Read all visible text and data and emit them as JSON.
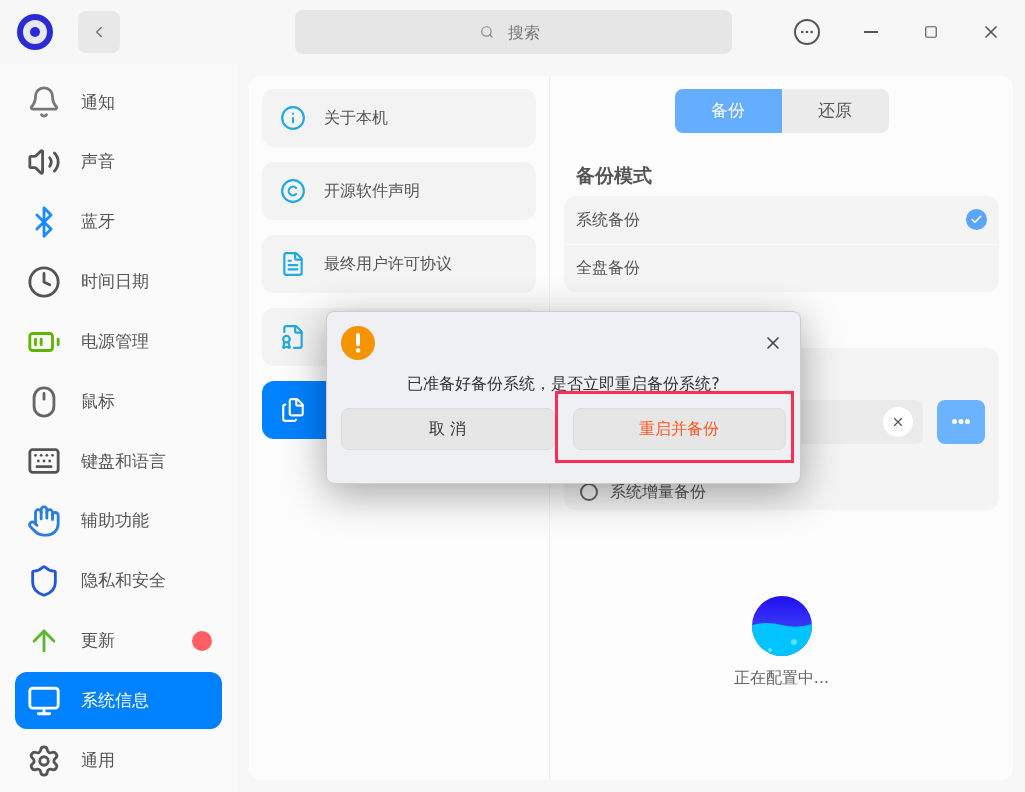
{
  "window": {
    "search": {
      "placeholder": "搜索"
    }
  },
  "sidebar": {
    "items": [
      {
        "label": "通知",
        "selected": false,
        "notification": false
      },
      {
        "label": "声音",
        "selected": false,
        "notification": false
      },
      {
        "label": "蓝牙",
        "selected": false,
        "notification": false
      },
      {
        "label": "时间日期",
        "selected": false,
        "notification": false
      },
      {
        "label": "电源管理",
        "selected": false,
        "notification": false
      },
      {
        "label": "鼠标",
        "selected": false,
        "notification": false
      },
      {
        "label": "键盘和语言",
        "selected": false,
        "notification": false
      },
      {
        "label": "辅助功能",
        "selected": false,
        "notification": false
      },
      {
        "label": "隐私和安全",
        "selected": false,
        "notification": false
      },
      {
        "label": "更新",
        "selected": false,
        "notification": true
      },
      {
        "label": "系统信息",
        "selected": true,
        "notification": false
      },
      {
        "label": "通用",
        "selected": false,
        "notification": false
      }
    ]
  },
  "info_menu": {
    "items": [
      {
        "label": "关于本机",
        "selected": false
      },
      {
        "label": "开源软件声明",
        "selected": false
      },
      {
        "label": "最终用户许可协议",
        "selected": false
      },
      {
        "selected": false
      },
      {
        "selected": true
      }
    ]
  },
  "backup": {
    "tabs": [
      {
        "label": "备份",
        "selected": true
      },
      {
        "label": "还原",
        "selected": false
      }
    ],
    "mode_title": "备份模式",
    "modes": [
      {
        "label": "系统备份",
        "checked": true
      },
      {
        "label": "全盘备份",
        "checked": false
      }
    ],
    "incremental_option": {
      "label": "系统增量备份",
      "selected": false
    },
    "status": "正在配置中..."
  },
  "dialog": {
    "message": "已准备好备份系统，是否立即重启备份系统?",
    "buttons": [
      {
        "label": "取 消",
        "kind": "cancel",
        "highlighted": false
      },
      {
        "label": "重启并备份",
        "kind": "confirm",
        "highlighted": true
      }
    ]
  }
}
